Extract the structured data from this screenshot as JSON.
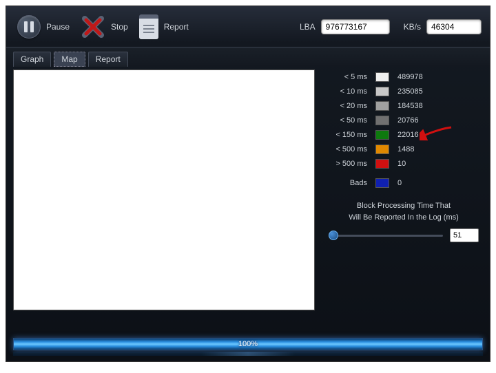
{
  "toolbar": {
    "pause_label": "Pause",
    "stop_label": "Stop",
    "report_label": "Report",
    "lba_label": "LBA",
    "lba_value": "976773167",
    "kbs_label": "KB/s",
    "kbs_value": "46304"
  },
  "tabs": {
    "graph": "Graph",
    "map": "Map",
    "report": "Report"
  },
  "legend": {
    "items": [
      {
        "label": "< 5 ms",
        "color": "#f0f0f0",
        "value": "489978"
      },
      {
        "label": "< 10 ms",
        "color": "#c8c8c8",
        "value": "235085"
      },
      {
        "label": "< 20 ms",
        "color": "#a0a0a0",
        "value": "184538"
      },
      {
        "label": "< 50 ms",
        "color": "#707070",
        "value": "20766"
      },
      {
        "label": "< 150 ms",
        "color": "#0e7a0e",
        "value": "22016"
      },
      {
        "label": "< 500 ms",
        "color": "#e08800",
        "value": "1488"
      },
      {
        "label": "> 500 ms",
        "color": "#d01010",
        "value": "10"
      }
    ],
    "bads_label": "Bads",
    "bads_color": "#1020b0",
    "bads_value": "0"
  },
  "slider": {
    "title_line1": "Block Processing Time That",
    "title_line2": "Will Be Reported In the Log (ms)",
    "value": "51"
  },
  "progress": {
    "percent": "100%"
  }
}
